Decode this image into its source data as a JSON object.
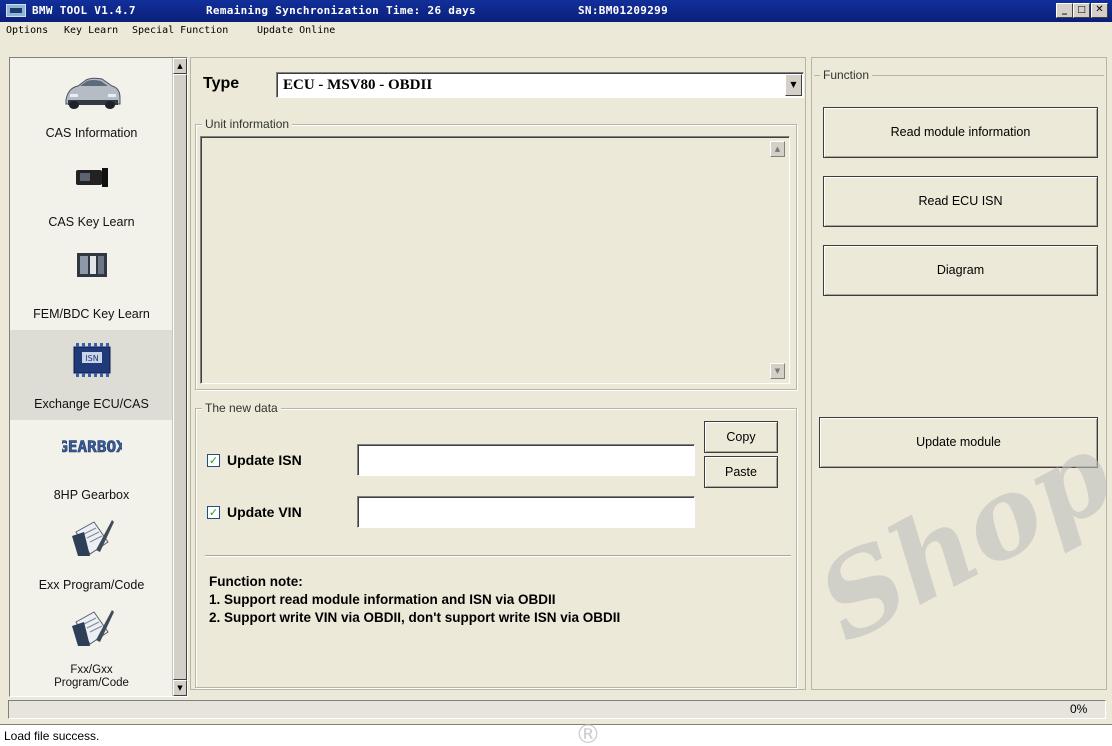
{
  "titlebar": {
    "app_name": "BMW TOOL V1.4.7",
    "sync_text": "Remaining Synchronization Time: 26 days",
    "serial": "SN:BM01209299",
    "min": "_",
    "max": "□",
    "close": "✕"
  },
  "menu": [
    {
      "label": "Options"
    },
    {
      "label": "Key Learn"
    },
    {
      "label": "Special Function"
    },
    {
      "label": "Update Online"
    }
  ],
  "sidebar": {
    "items": [
      {
        "label": "CAS Information",
        "icon": "car-icon"
      },
      {
        "label": "CAS Key Learn",
        "icon": "key-module-icon"
      },
      {
        "label": "FEM/BDC Key Learn",
        "icon": "fem-module-icon"
      },
      {
        "label": "Exchange ECU/CAS",
        "icon": "isn-chip-icon",
        "active": true,
        "chip_text": "ISN"
      },
      {
        "label": "8HP Gearbox",
        "icon": "gearbox-icon",
        "logo_text": "GEARBOX"
      },
      {
        "label": "Exx Program/Code",
        "icon": "document-icon"
      },
      {
        "label": "Fxx/Gxx\nProgram/Code",
        "icon": "document-icon"
      }
    ]
  },
  "main": {
    "type_label": "Type",
    "type_value": "ECU - MSV80 - OBDII",
    "unit_info_title": "Unit information",
    "new_data_title": "The new data",
    "update_isn_label": "Update ISN",
    "update_vin_label": "Update VIN",
    "update_isn_checked": true,
    "update_vin_checked": true,
    "isn_value": "",
    "vin_value": "",
    "copy_label": "Copy",
    "paste_label": "Paste",
    "note_title": "Function note:",
    "note_1": "1. Support read module information and ISN via OBDII",
    "note_2": "2. Support write VIN via OBDII, don't support write ISN via OBDII"
  },
  "function_panel": {
    "title": "Function",
    "read_module_label": "Read module information",
    "read_isn_label": "Read ECU ISN",
    "diagram_label": "Diagram",
    "update_module_label": "Update module"
  },
  "progress": {
    "value": 0,
    "text": "0%"
  },
  "status": {
    "text": "Load file success."
  },
  "watermark": {
    "text": "Shop.us",
    "reg": "®"
  }
}
